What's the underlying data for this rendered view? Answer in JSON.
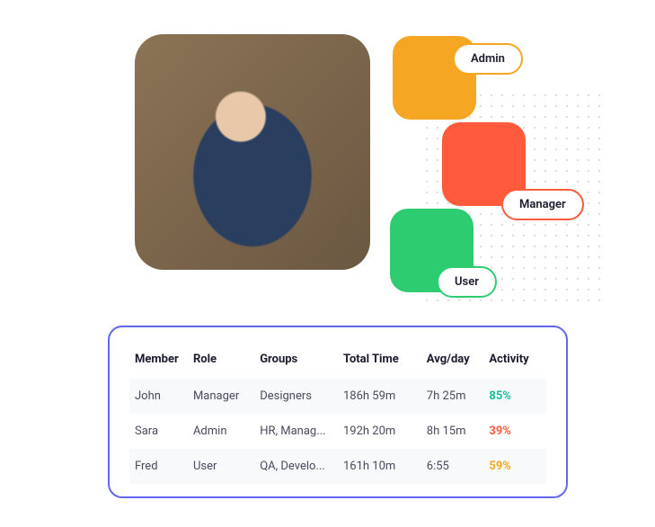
{
  "roles": {
    "admin": "Admin",
    "manager": "Manager",
    "user": "User"
  },
  "table": {
    "headers": {
      "member": "Member",
      "role": "Role",
      "groups": "Groups",
      "total_time": "Total Time",
      "avg_day": "Avg/day",
      "activity": "Activity"
    },
    "rows": [
      {
        "member": "John",
        "role": "Manager",
        "groups": "Designers",
        "total_time": "186h 59m",
        "avg_day": "7h 25m",
        "activity": "85%",
        "activity_color": "#1abc9c"
      },
      {
        "member": "Sara",
        "role": "Admin",
        "groups": "HR, Manag...",
        "total_time": "192h 20m",
        "avg_day": "8h 15m",
        "activity": "39%",
        "activity_color": "#ff5a3c"
      },
      {
        "member": "Fred",
        "role": "User",
        "groups": "QA, Develo...",
        "total_time": "161h 10m",
        "avg_day": "6:55",
        "activity": "59%",
        "activity_color": "#f5a623"
      }
    ]
  }
}
